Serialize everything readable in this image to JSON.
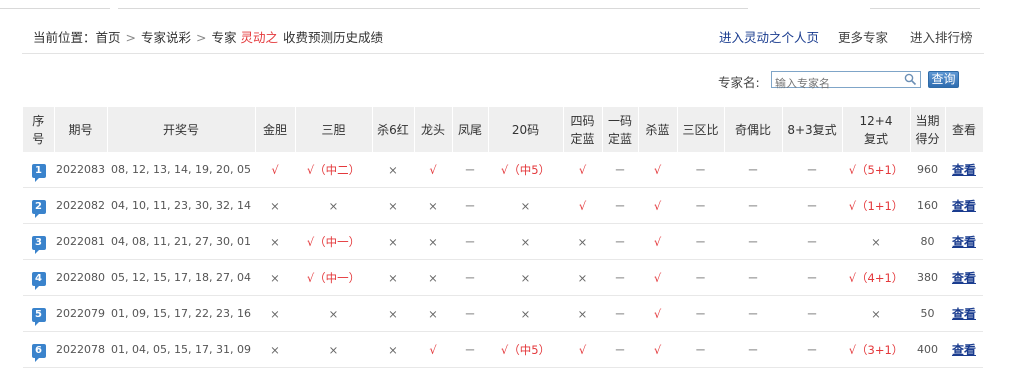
{
  "breadcrumb": {
    "prefix": "当前位置：",
    "items": [
      "首页",
      "专家说彩"
    ],
    "expert_word": "专家",
    "expert_name": "灵动之",
    "suffix": "收费预测历史成绩"
  },
  "right_links": [
    "进入灵动之个人页",
    "更多专家",
    "进入排行榜"
  ],
  "search": {
    "label": "专家名:",
    "placeholder": "输入专家名",
    "button": "查询"
  },
  "table": {
    "headers": [
      [
        "序",
        "号"
      ],
      [
        "期号"
      ],
      [
        "开奖号"
      ],
      [
        "金胆"
      ],
      [
        "三胆"
      ],
      [
        "杀6红"
      ],
      [
        "龙头"
      ],
      [
        "凤尾"
      ],
      [
        "20码"
      ],
      [
        "四码",
        "定蓝"
      ],
      [
        "一码",
        "定蓝"
      ],
      [
        "杀蓝"
      ],
      [
        "三区比"
      ],
      [
        "奇偶比"
      ],
      [
        "8+3复式"
      ],
      [
        "12+4",
        "复式"
      ],
      [
        "当期",
        "得分"
      ],
      [
        "查看"
      ]
    ],
    "rows": [
      {
        "no": "1",
        "period": "2022083",
        "numbers": "08, 12, 13, 14, 19, 20, 05",
        "jd": "√",
        "sd": "√（中二）",
        "s6": "×",
        "lt": "√",
        "fw": "－",
        "m20": "√（中5）",
        "s4": "√",
        "y1": "－",
        "sl": "√",
        "sq": "－",
        "jo": "－",
        "f83": "－",
        "f124": "√（5+1）",
        "score": "960",
        "view": "查看"
      },
      {
        "no": "2",
        "period": "2022082",
        "numbers": "04, 10, 11, 23, 30, 32, 14",
        "jd": "×",
        "sd": "×",
        "s6": "×",
        "lt": "×",
        "fw": "－",
        "m20": "×",
        "s4": "√",
        "y1": "－",
        "sl": "√",
        "sq": "－",
        "jo": "－",
        "f83": "－",
        "f124": "√（1+1）",
        "score": "160",
        "view": "查看"
      },
      {
        "no": "3",
        "period": "2022081",
        "numbers": "04, 08, 11, 21, 27, 30, 01",
        "jd": "×",
        "sd": "√（中一）",
        "s6": "×",
        "lt": "×",
        "fw": "－",
        "m20": "×",
        "s4": "×",
        "y1": "－",
        "sl": "√",
        "sq": "－",
        "jo": "－",
        "f83": "－",
        "f124": "×",
        "score": "80",
        "view": "查看"
      },
      {
        "no": "4",
        "period": "2022080",
        "numbers": "05, 12, 15, 17, 18, 27, 04",
        "jd": "×",
        "sd": "√（中一）",
        "s6": "×",
        "lt": "×",
        "fw": "－",
        "m20": "×",
        "s4": "×",
        "y1": "－",
        "sl": "√",
        "sq": "－",
        "jo": "－",
        "f83": "－",
        "f124": "√（4+1）",
        "score": "380",
        "view": "查看"
      },
      {
        "no": "5",
        "period": "2022079",
        "numbers": "01, 09, 15, 17, 22, 23, 16",
        "jd": "×",
        "sd": "×",
        "s6": "×",
        "lt": "×",
        "fw": "－",
        "m20": "×",
        "s4": "×",
        "y1": "－",
        "sl": "√",
        "sq": "－",
        "jo": "－",
        "f83": "－",
        "f124": "×",
        "score": "50",
        "view": "查看"
      },
      {
        "no": "6",
        "period": "2022078",
        "numbers": "01, 04, 05, 15, 17, 31, 09",
        "jd": "×",
        "sd": "×",
        "s6": "×",
        "lt": "√",
        "fw": "－",
        "m20": "√（中5）",
        "s4": "√",
        "y1": "－",
        "sl": "√",
        "sq": "－",
        "jo": "－",
        "f83": "－",
        "f124": "√（3+1）",
        "score": "400",
        "view": "查看"
      }
    ]
  },
  "colors": {
    "hit": "#e4393c",
    "link": "#1a3c8f",
    "badge": "#3a83cc",
    "header_bg": "#efefef"
  }
}
